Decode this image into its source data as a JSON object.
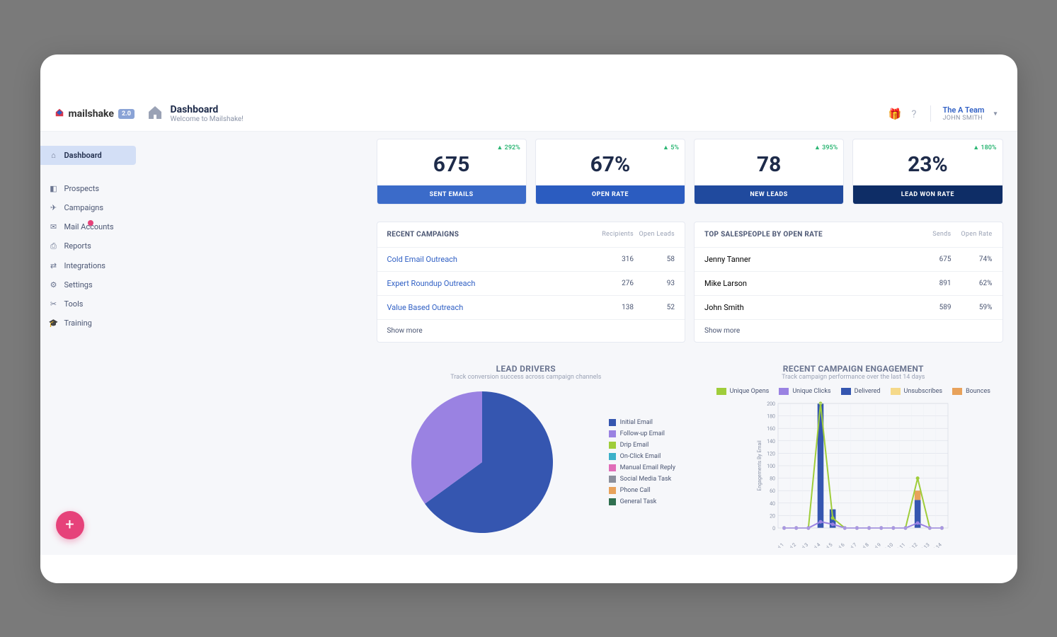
{
  "brand": "mailshake",
  "brand_badge": "2.0",
  "header": {
    "title": "Dashboard",
    "subtitle": "Welcome to Mailshake!",
    "team": "The A Team",
    "user": "JOHN SMITH"
  },
  "sidebar": [
    {
      "label": "Dashboard",
      "active": true
    },
    {
      "label": "Prospects"
    },
    {
      "label": "Campaigns"
    },
    {
      "label": "Mail Accounts",
      "badge": true
    },
    {
      "label": "Reports"
    },
    {
      "label": "Integrations"
    },
    {
      "label": "Settings"
    },
    {
      "label": "Tools"
    },
    {
      "label": "Training"
    }
  ],
  "kpis": [
    {
      "value": "675",
      "label": "SENT EMAILS",
      "delta": "292%"
    },
    {
      "value": "67%",
      "label": "OPEN RATE",
      "delta": "5%"
    },
    {
      "value": "78",
      "label": "NEW LEADS",
      "delta": "395%"
    },
    {
      "value": "23%",
      "label": "LEAD WON RATE",
      "delta": "180%"
    }
  ],
  "recent_campaigns": {
    "title": "RECENT CAMPAIGNS",
    "cols": [
      "Recipients",
      "Open Leads"
    ],
    "rows": [
      {
        "name": "Cold Email Outreach",
        "c1": "316",
        "c2": "58"
      },
      {
        "name": "Expert Roundup Outreach",
        "c1": "276",
        "c2": "93"
      },
      {
        "name": "Value Based Outreach",
        "c1": "138",
        "c2": "52"
      }
    ],
    "more": "Show more"
  },
  "top_sales": {
    "title": "TOP SALESPEOPLE BY OPEN RATE",
    "cols": [
      "Sends",
      "Open Rate"
    ],
    "rows": [
      {
        "name": "Jenny Tanner",
        "c1": "675",
        "c2": "74%"
      },
      {
        "name": "Mike Larson",
        "c1": "891",
        "c2": "62%"
      },
      {
        "name": "John Smith",
        "c1": "589",
        "c2": "59%"
      }
    ],
    "more": "Show more"
  },
  "lead_drivers": {
    "title": "LEAD DRIVERS",
    "subtitle": "Track conversion success across campaign channels"
  },
  "engagement": {
    "title": "RECENT CAMPAIGN ENGAGEMENT",
    "subtitle": "Track campaign performance over the last 14 days",
    "ylabel": "Engagements By Email"
  },
  "chart_data": [
    {
      "type": "pie",
      "title": "LEAD DRIVERS",
      "categories": [
        "Initial Email",
        "Follow-up Email",
        "Drip Email",
        "On-Click Email",
        "Manual Email Reply",
        "Social Media Task",
        "Phone Call",
        "General Task"
      ],
      "values": [
        65,
        35,
        0,
        0,
        0,
        0,
        0,
        0
      ],
      "colors": [
        "#3556b0",
        "#9a82e2",
        "#9fcd3a",
        "#3bb0c9",
        "#e06db8",
        "#8a8f9c",
        "#e8a25b",
        "#2f6f4f"
      ]
    },
    {
      "type": "bar",
      "stacked": true,
      "title": "RECENT CAMPAIGN ENGAGEMENT",
      "xlabel": "",
      "ylabel": "Engagements By Email",
      "ylim": [
        0,
        200
      ],
      "categories": [
        "Jul 1",
        "Jul 2",
        "Jul 3",
        "Jul 4",
        "Jul 5",
        "Jul 6",
        "Jul 7",
        "Jul 8",
        "Jul 9",
        "Jul 10",
        "Jul 11",
        "Jul 12",
        "Jul 13",
        "Jul 14"
      ],
      "series": [
        {
          "name": "Delivered",
          "color": "#3556b0",
          "values": [
            0,
            0,
            0,
            200,
            30,
            0,
            0,
            0,
            0,
            0,
            0,
            45,
            0,
            0
          ]
        },
        {
          "name": "Bounces",
          "color": "#e8a25b",
          "values": [
            0,
            0,
            0,
            0,
            0,
            0,
            0,
            0,
            0,
            0,
            0,
            15,
            0,
            0
          ]
        },
        {
          "name": "Unsubscribes",
          "color": "#f5d98a",
          "values": [
            0,
            0,
            0,
            0,
            0,
            0,
            0,
            0,
            0,
            0,
            0,
            0,
            0,
            0
          ]
        }
      ],
      "lines": [
        {
          "name": "Unique Opens",
          "color": "#9fcd3a",
          "values": [
            0,
            0,
            0,
            200,
            16,
            0,
            0,
            0,
            0,
            0,
            0,
            80,
            0,
            0
          ]
        },
        {
          "name": "Unique Clicks",
          "color": "#9a82e2",
          "values": [
            0,
            0,
            0,
            10,
            6,
            0,
            0,
            0,
            0,
            0,
            0,
            8,
            0,
            0
          ]
        }
      ],
      "legend": [
        "Unique Opens",
        "Unique Clicks",
        "Delivered",
        "Unsubscribes",
        "Bounces"
      ],
      "legend_colors": [
        "#9fcd3a",
        "#9a82e2",
        "#3556b0",
        "#f5d98a",
        "#e8a25b"
      ]
    }
  ]
}
